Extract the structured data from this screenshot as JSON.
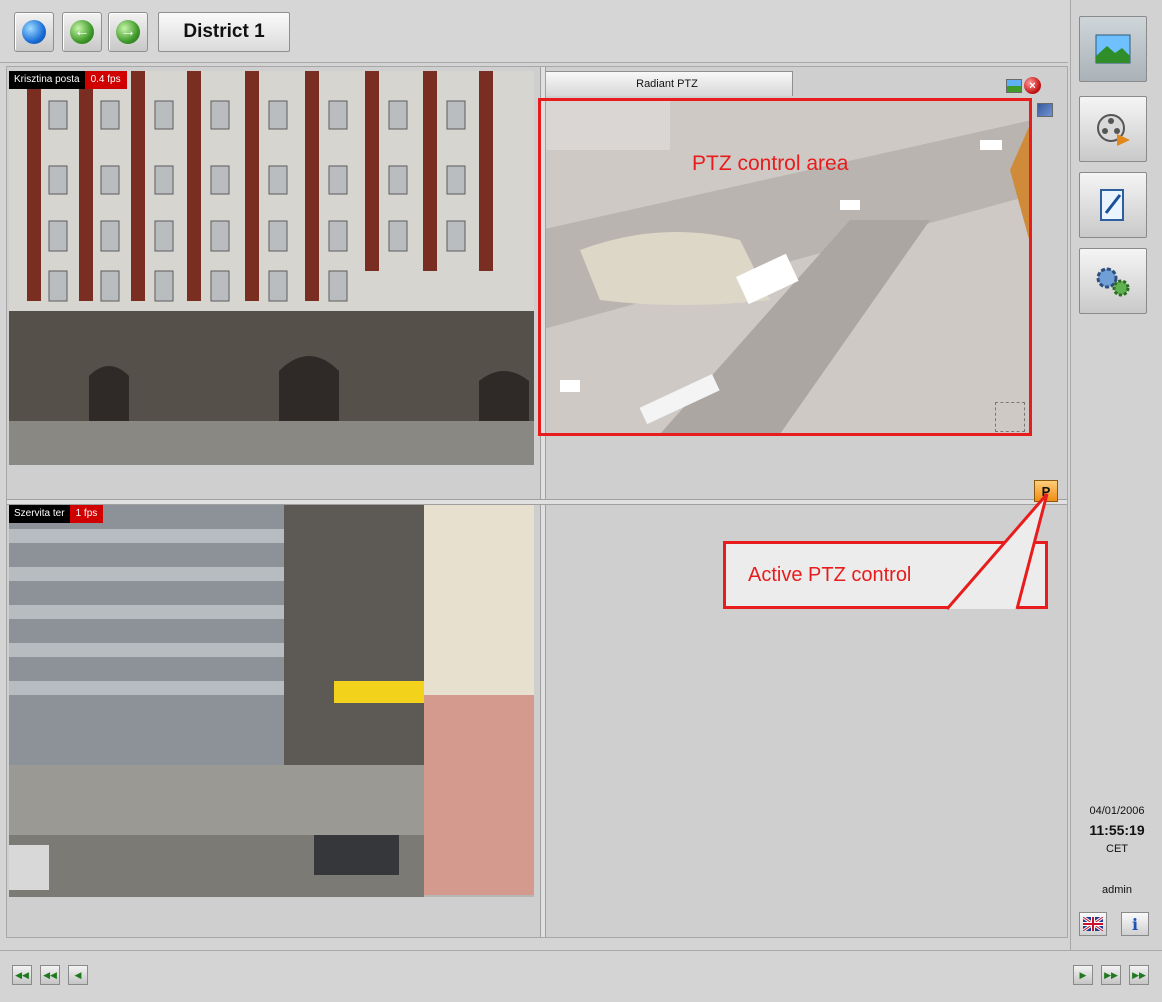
{
  "toolbar": {
    "district_label": "District 1",
    "buttons": [
      "home-globe",
      "back",
      "forward"
    ]
  },
  "cameras": {
    "cam1": {
      "name": "Krisztina posta",
      "fps": "0.4 fps"
    },
    "cam2": {
      "name": "Szervita ter",
      "fps": "1 fps"
    },
    "cam3": {
      "name": "Radiant PTZ"
    }
  },
  "annotations": {
    "ptz_area": "PTZ control area",
    "active_ptz": "Active PTZ control",
    "p_button": "P"
  },
  "sidebar": {
    "date": "04/01/2006",
    "time": "11:55:19",
    "timezone": "CET",
    "user": "admin",
    "info_label": "i"
  },
  "colors": {
    "annotation_red": "#e81c1c",
    "fps_badge": "#d10000",
    "ptz_button": "#f0a030"
  }
}
